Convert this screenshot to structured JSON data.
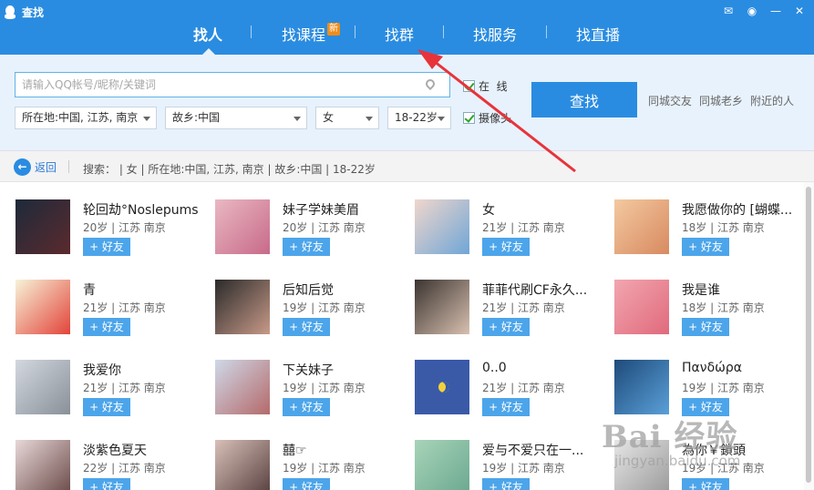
{
  "window": {
    "title": "查找",
    "controls": [
      "feedback-icon",
      "skin-icon",
      "minimize-icon",
      "close-icon"
    ]
  },
  "nav": {
    "tabs": [
      {
        "label": "找人",
        "active": true
      },
      {
        "label": "找课程",
        "badge": "新"
      },
      {
        "label": "找群"
      },
      {
        "label": "找服务"
      },
      {
        "label": "找直播"
      }
    ]
  },
  "search": {
    "placeholder": "请输入QQ帐号/昵称/关键词",
    "location": "所在地:中国, 江苏, 南京",
    "hometown": "故乡:中国",
    "gender": "女",
    "age": "18-22岁",
    "online_label": "在  线",
    "camera_label": "摄像头",
    "find_button": "查找",
    "quick_links": [
      "同城交友",
      "同城老乡",
      "附近的人"
    ]
  },
  "filter": {
    "back_label": "返回",
    "summary": "搜索：  |  女  |  所在地:中国, 江苏, 南京  |  故乡:中国  |  18-22岁"
  },
  "add_label": "+ 好友",
  "results": [
    {
      "nick": "轮回劫°Noslepums",
      "meta": "20岁 | 江苏 南京"
    },
    {
      "nick": "妹子学妹美眉",
      "meta": "20岁 | 江苏 南京"
    },
    {
      "nick": "女",
      "meta": "21岁 | 江苏 南京"
    },
    {
      "nick": "我愿做你的 [蝴蝶...",
      "meta": "18岁 | 江苏 南京"
    },
    {
      "nick": "青",
      "meta": "21岁 | 江苏 南京"
    },
    {
      "nick": "后知后觉",
      "meta": "19岁 | 江苏 南京"
    },
    {
      "nick": "菲菲代刷CF永久...",
      "meta": "21岁 | 江苏 南京"
    },
    {
      "nick": "我是谁",
      "meta": "18岁 | 江苏 南京"
    },
    {
      "nick": "我爱你",
      "meta": "21岁 | 江苏 南京"
    },
    {
      "nick": "下关妹子",
      "meta": "19岁 | 江苏 南京"
    },
    {
      "nick": "0..0",
      "meta": "21岁 | 江苏 南京"
    },
    {
      "nick": "Πανδώρα",
      "meta": "19岁 | 江苏 南京"
    },
    {
      "nick": "淡紫色夏天",
      "meta": "22岁 | 江苏 南京"
    },
    {
      "nick": "囍☞",
      "meta": "19岁 | 江苏 南京"
    },
    {
      "nick": "爱与不爱只在一...",
      "meta": "19岁 | 江苏 南京"
    },
    {
      "nick": "為你￥鎖頭",
      "meta": "19岁 | 江苏 南京"
    }
  ],
  "watermark": {
    "big": "Bai 经验",
    "small": "jingyan.baidu.com"
  },
  "colors": {
    "brand": "#2a8ce0",
    "panel": "#e8f2fc",
    "add_button": "#4ca5ea",
    "annotation": "#e8333a"
  }
}
